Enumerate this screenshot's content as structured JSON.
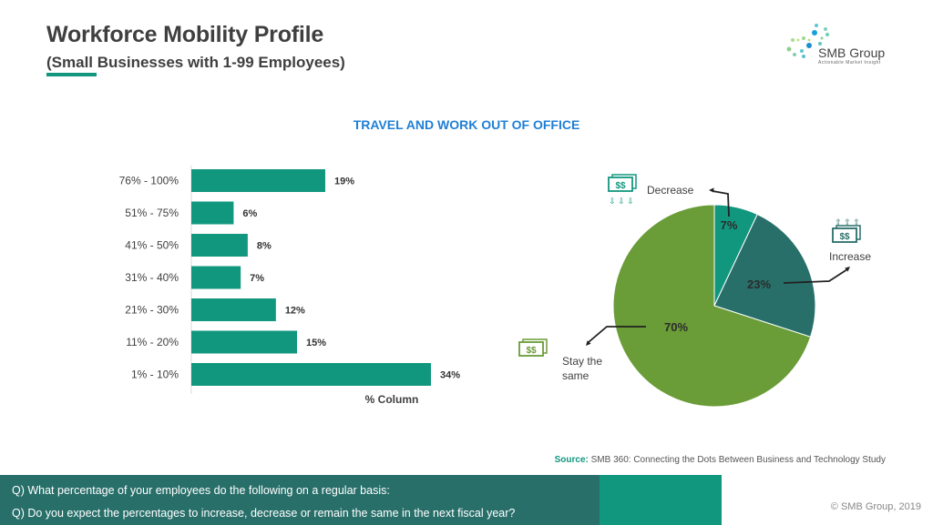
{
  "header": {
    "title": "Workforce Mobility Profile",
    "subtitle": "(Small Businesses with 1-99 Employees)"
  },
  "logo": {
    "name": "SMB Group",
    "tagline": "Actionable Market Insight"
  },
  "colors": {
    "teal": "#12977f",
    "dark_teal": "#286f6a",
    "green": "#6a9c37",
    "title_blue": "#1f7fd6"
  },
  "chart_title": "TRAVEL AND WORK OUT OF OFFICE",
  "chart_data": [
    {
      "type": "bar",
      "orientation": "horizontal",
      "categories": [
        "76% - 100%",
        "51% - 75%",
        "41% - 50%",
        "31% - 40%",
        "21% - 30%",
        "11% - 20%",
        "1% - 10%"
      ],
      "values": [
        19,
        6,
        8,
        7,
        12,
        15,
        34
      ],
      "labels": [
        "19%",
        "6%",
        "8%",
        "7%",
        "12%",
        "15%",
        "34%"
      ],
      "xlabel": "% Column",
      "xlim": [
        0,
        36
      ],
      "grid": false
    },
    {
      "type": "pie",
      "categories": [
        "Decrease",
        "Increase",
        "Stay the same"
      ],
      "values": [
        7,
        23,
        70
      ],
      "labels": [
        "7%",
        "23%",
        "70%"
      ],
      "legend_labels": [
        "Decrease",
        "Increase",
        "Stay the\nsame"
      ]
    }
  ],
  "source": {
    "label": "Source:",
    "text": "SMB 360: Connecting the Dots Between Business and Technology Study"
  },
  "footer": {
    "q1": "Q) What percentage of your employees do the following on a regular basis:",
    "q2": "Q) Do you expect the percentages to increase, decrease or remain the same in the next fiscal year?",
    "copyright": "© SMB Group, 2019"
  }
}
